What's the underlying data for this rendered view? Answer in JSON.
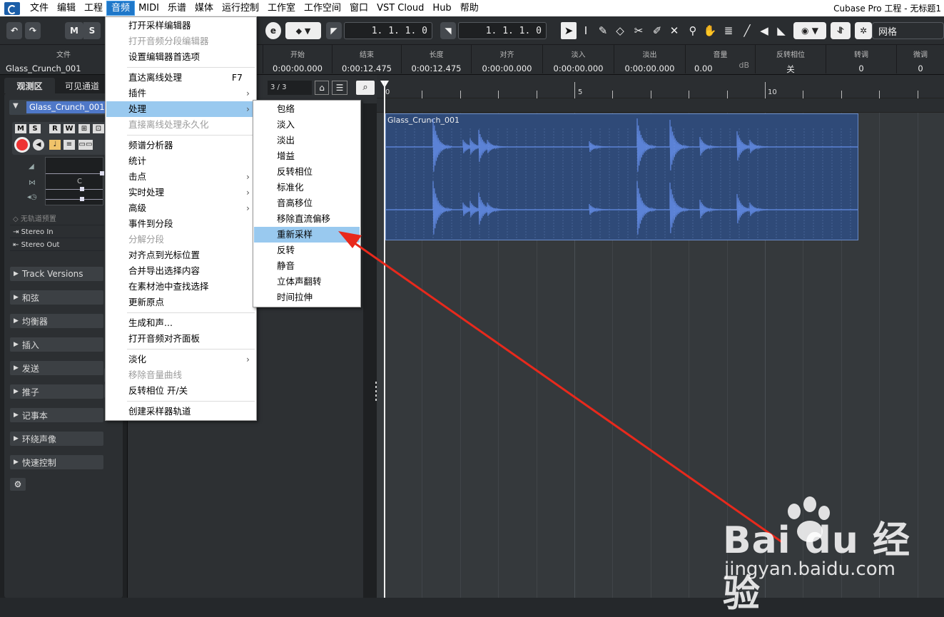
{
  "menubar": {
    "items": [
      "文件",
      "编辑",
      "工程",
      "音频",
      "MIDI",
      "乐谱",
      "媒体",
      "运行控制",
      "工作室",
      "工作空间",
      "窗口",
      "VST Cloud",
      "Hub",
      "帮助"
    ],
    "active": "音频",
    "window_title": "Cubase Pro 工程 - 无标题1"
  },
  "toolbar": {
    "m_label": "M",
    "s_label": "S",
    "position_left": "1. 1. 1.  0",
    "position_right": "1. 1. 1.  0",
    "snap_label": "网格"
  },
  "infoline": {
    "file_header": "文件",
    "file_name": "Glass_Crunch_001",
    "columns": [
      {
        "header": "开始",
        "value": "0:00:00.000"
      },
      {
        "header": "结束",
        "value": "0:00:12.475"
      },
      {
        "header": "长度",
        "value": "0:00:12.475"
      },
      {
        "header": "对齐",
        "value": "0:00:00.000"
      },
      {
        "header": "淡入",
        "value": "0:00:00.000"
      },
      {
        "header": "淡出",
        "value": "0:00:00.000"
      },
      {
        "header": "音量",
        "value": "0.00",
        "unit": "dB"
      },
      {
        "header": "反转相位",
        "value": "关"
      },
      {
        "header": "转调",
        "value": "0"
      },
      {
        "header": "微调",
        "value": "0"
      }
    ]
  },
  "inspector": {
    "tabs": [
      "观测区",
      "可见通道"
    ],
    "track_name": "Glass_Crunch_001",
    "buttons": [
      "M",
      "S",
      "R",
      "W"
    ],
    "pan_label": "C",
    "routing": [
      "无轨道预置",
      "Stereo In",
      "Stereo Out"
    ],
    "sections": [
      "Track Versions",
      "和弦",
      "均衡器",
      "插入",
      "发送",
      "推子",
      "记事本",
      "环绕声像",
      "快速控制"
    ]
  },
  "tracklist": {
    "counter": "3 / 3"
  },
  "ruler": {
    "marks": [
      "0",
      "5",
      "10"
    ]
  },
  "audio_event": {
    "name": "Glass_Crunch_001",
    "color": "#5b82d6"
  },
  "audio_menu": {
    "items": [
      {
        "label": "打开采样编辑器"
      },
      {
        "label": "打开音频分段编辑器",
        "disabled": true
      },
      {
        "label": "设置编辑器首选项"
      },
      {
        "sep": true
      },
      {
        "label": "直达离线处理",
        "shortcut": "F7"
      },
      {
        "label": "插件",
        "sub": true
      },
      {
        "label": "处理",
        "sub": true,
        "highlight": true
      },
      {
        "label": "直接离线处理永久化",
        "disabled": true
      },
      {
        "sep": true
      },
      {
        "label": "频谱分析器"
      },
      {
        "label": "统计"
      },
      {
        "label": "击点",
        "sub": true
      },
      {
        "label": "实时处理",
        "sub": true
      },
      {
        "label": "高级",
        "sub": true
      },
      {
        "label": "事件到分段"
      },
      {
        "label": "分解分段",
        "disabled": true
      },
      {
        "label": "对齐点到光标位置"
      },
      {
        "label": "合并导出选择内容"
      },
      {
        "label": "在素材池中查找选择"
      },
      {
        "label": "更新原点"
      },
      {
        "sep": true
      },
      {
        "label": "生成和声..."
      },
      {
        "label": "打开音频对齐面板"
      },
      {
        "sep": true
      },
      {
        "label": "淡化",
        "sub": true
      },
      {
        "label": "移除音量曲线",
        "disabled": true
      },
      {
        "label": "反转相位 开/关"
      },
      {
        "sep": true
      },
      {
        "label": "创建采样器轨道"
      }
    ]
  },
  "process_menu": {
    "items": [
      {
        "label": "包络"
      },
      {
        "label": "淡入"
      },
      {
        "label": "淡出"
      },
      {
        "label": "增益"
      },
      {
        "label": "反转相位"
      },
      {
        "label": "标准化"
      },
      {
        "label": "音高移位"
      },
      {
        "label": "移除直流偏移"
      },
      {
        "label": "重新采样",
        "highlight": true
      },
      {
        "label": "反转"
      },
      {
        "label": "静音"
      },
      {
        "label": "立体声翻转"
      },
      {
        "label": "时间拉伸"
      }
    ]
  },
  "annotation": {
    "arrow_color": "#e8291c"
  },
  "watermark": {
    "brand": "Bai du 经验",
    "url": "jingyan.baidu.com"
  }
}
